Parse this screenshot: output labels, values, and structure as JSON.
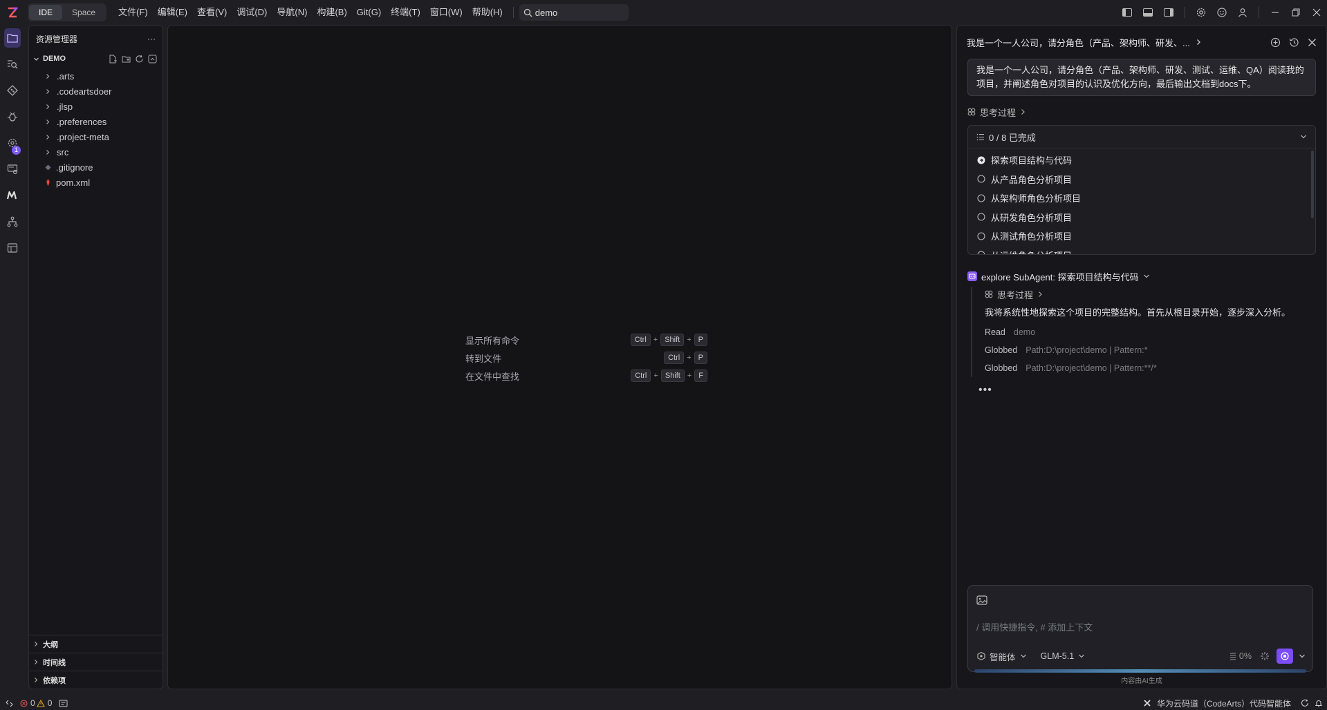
{
  "titlebar": {
    "modes": [
      "IDE",
      "Space"
    ],
    "active_mode": "IDE",
    "menu": [
      "文件(F)",
      "编辑(E)",
      "查看(V)",
      "调试(D)",
      "导航(N)",
      "构建(B)",
      "Git(G)",
      "终端(T)",
      "窗口(W)",
      "帮助(H)"
    ],
    "search_value": "demo"
  },
  "activity": {
    "badge_count": "1",
    "accent": "#7c5cff"
  },
  "explorer": {
    "title": "资源管理器",
    "more": "···",
    "project": "DEMO",
    "items": [
      {
        "label": ".arts",
        "type": "folder"
      },
      {
        "label": ".codeartsdoer",
        "type": "folder"
      },
      {
        "label": ".jlsp",
        "type": "folder"
      },
      {
        "label": ".preferences",
        "type": "folder"
      },
      {
        "label": ".project-meta",
        "type": "folder"
      },
      {
        "label": "src",
        "type": "folder"
      },
      {
        "label": ".gitignore",
        "type": "file"
      },
      {
        "label": "pom.xml",
        "type": "file"
      }
    ],
    "sections": [
      "大纲",
      "时间线",
      "依赖项"
    ]
  },
  "editor": {
    "hints": [
      {
        "label": "显示所有命令",
        "keys": [
          "Ctrl",
          "Shift",
          "P"
        ]
      },
      {
        "label": "转到文件",
        "keys": [
          "Ctrl",
          "P"
        ]
      },
      {
        "label": "在文件中查找",
        "keys": [
          "Ctrl",
          "Shift",
          "F"
        ]
      }
    ]
  },
  "ai": {
    "title": "我是一个一人公司，请分角色（产品、架构师、研发、...",
    "prompt": "我是一个一人公司，请分角色（产品、架构师、研发、测试、运维、QA）阅读我的项目，并阐述角色对项目的认识及优化方向，最后输出文档到docs下。",
    "thinking_label": "思考过程",
    "todo_summary": "0 / 8 已完成",
    "todos": [
      {
        "label": "探索项目结构与代码",
        "state": "in-progress"
      },
      {
        "label": "从产品角色分析项目",
        "state": "pending"
      },
      {
        "label": "从架构师角色分析项目",
        "state": "pending"
      },
      {
        "label": "从研发角色分析项目",
        "state": "pending"
      },
      {
        "label": "从测试角色分析项目",
        "state": "pending"
      },
      {
        "label": "从运维角色分析项目",
        "state": "pending"
      }
    ],
    "subagent": "explore SubAgent: 探索项目结构与代码",
    "sub_thinking": "思考过程",
    "message": "我将系统性地探索这个项目的完整结构。首先从根目录开始，逐步深入分析。",
    "tools": [
      {
        "action": "Read",
        "detail": "demo"
      },
      {
        "action": "Globbed",
        "detail": "Path:D:\\project\\demo | Pattern:*"
      },
      {
        "action": "Globbed",
        "detail": "Path:D:\\project\\demo | Pattern:**/*"
      }
    ],
    "loading": "•••",
    "input_placeholder": "/ 调用快捷指令, # 添加上下文",
    "agent_mode": "智能体",
    "model": "GLM-5.1",
    "context_pct": "0%",
    "footer": "内容由AI生成"
  },
  "status": {
    "errors": "0",
    "warnings": "0",
    "right_label": "华为云码道（CodeArts）代码智能体"
  }
}
